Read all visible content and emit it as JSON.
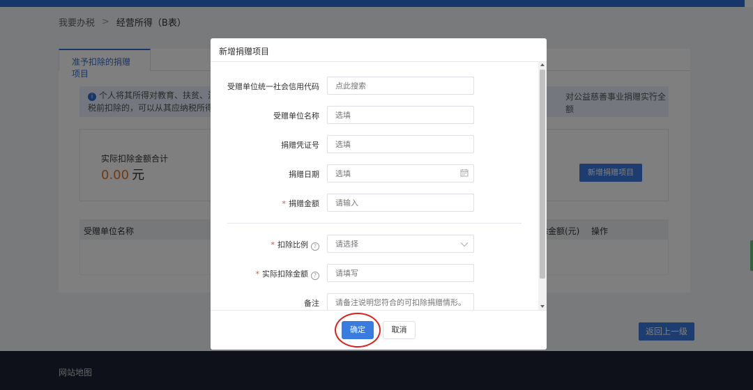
{
  "colors": {
    "primary": "#3a7be0",
    "amount_orange": "#e6741c",
    "required_red": "#e84a4a",
    "annotation_ring": "#e02020"
  },
  "breadcrumb": {
    "root": "我要办税",
    "separator": ">",
    "current": "经营所得（B表）"
  },
  "background": {
    "active_tab": "准予扣除的捐赠项目",
    "notice": {
      "icon": "info-icon",
      "line1": "个人将其所得对教育、扶贫、济区",
      "line1_right": "对公益慈善事业捐赠实行全额",
      "line2": "税前扣除的，可以从其应纳税所得额中",
      "close_icon": "close-icon"
    },
    "summary": {
      "label": "实际扣除金额合计",
      "value": "0.00",
      "unit": "元",
      "add_button": "新增捐赠项目"
    },
    "table": {
      "col_name": "受赠单位名称",
      "col_amount": "除金额(元)",
      "col_operation": "操作"
    },
    "back_button": "返回上一级",
    "site_footer": "网站地图"
  },
  "modal": {
    "title": "新增捐赠项目",
    "fields": [
      {
        "label": "受赠单位统一社会信用代码",
        "placeholder": "点此搜索",
        "required": false
      },
      {
        "label": "受赠单位名称",
        "placeholder": "选填",
        "required": false
      },
      {
        "label": "捐赠凭证号",
        "placeholder": "选填",
        "required": false
      },
      {
        "label": "捐赠日期",
        "placeholder": "选填",
        "required": false,
        "icon": "calendar-icon"
      },
      {
        "label": "捐赠金额",
        "placeholder": "请输入",
        "required": true
      },
      {
        "label": "扣除比例",
        "placeholder": "请选择",
        "required": true,
        "help": true,
        "icon": "chevron-down-icon"
      },
      {
        "label": "实际扣除金额",
        "placeholder": "请填写",
        "required": true,
        "help": true
      },
      {
        "label": "备注",
        "placeholder": "请备注说明您符合的可扣除捐赠情形。",
        "required": false
      }
    ],
    "required_mark": "*",
    "help_mark": "?",
    "confirm_button": "确定",
    "cancel_button": "取消"
  }
}
